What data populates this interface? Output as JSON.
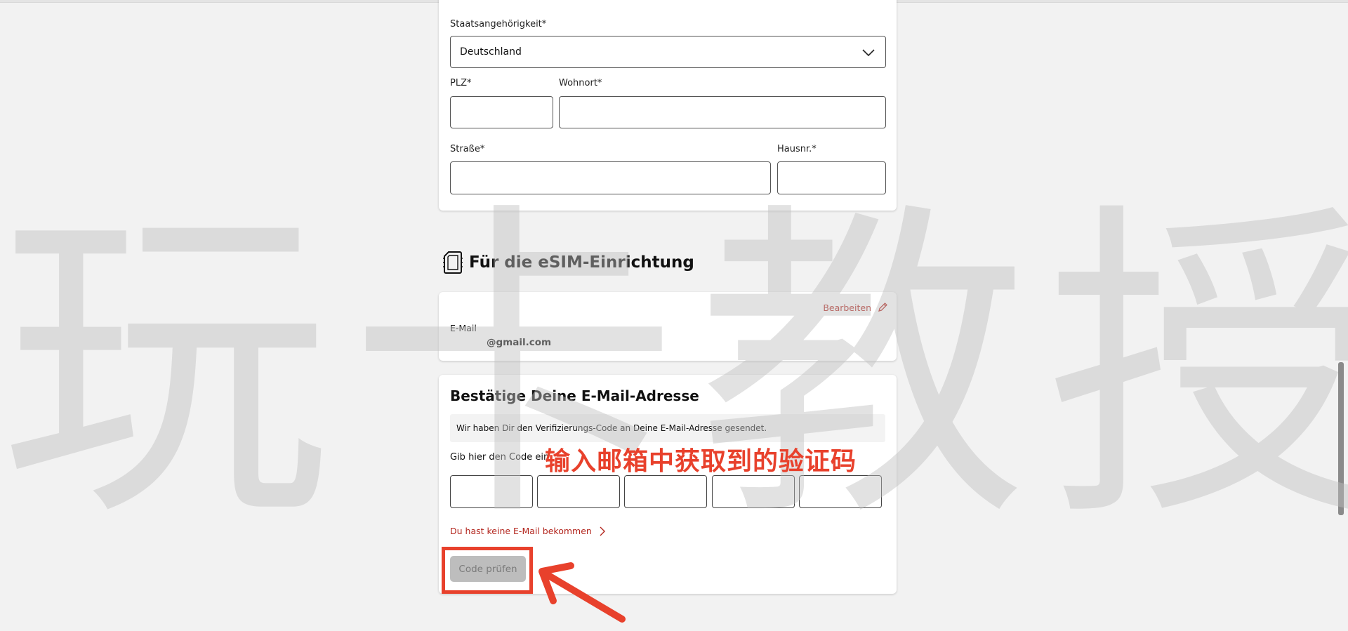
{
  "address_form": {
    "nationality_label": "Staatsangehörigkeit*",
    "nationality_value": "Deutschland",
    "plz_label": "PLZ*",
    "city_label": "Wohnort*",
    "street_label": "Straße*",
    "house_no_label": "Hausnr.*",
    "plz_value": "",
    "city_value": "",
    "street_value": "",
    "house_no_value": ""
  },
  "esim_section": {
    "title": "Für die eSIM-Einrichtung",
    "icon": "sim-card-icon",
    "edit_label": "Bearbeiten",
    "email_label": "E-Mail",
    "email_value": "@gmail.com"
  },
  "verify_section": {
    "title": "Bestätige Deine E-Mail-Adresse",
    "info_text": "Wir haben Dir den Verifizierungs-Code an Deine E-Mail-Adresse gesendet.",
    "code_label": "Gib hier den Code ein",
    "code_digits": [
      "",
      "",
      "",
      "",
      ""
    ],
    "resend_label": "Du hast keine E-Mail bekommen",
    "submit_label": "Code prüfen"
  },
  "overlay": {
    "watermark": [
      "玩",
      "卡",
      "教",
      "授"
    ],
    "annotation": "输入邮箱中获取到的验证码",
    "accent_color": "#e8412c",
    "link_color": "#b3261e"
  }
}
